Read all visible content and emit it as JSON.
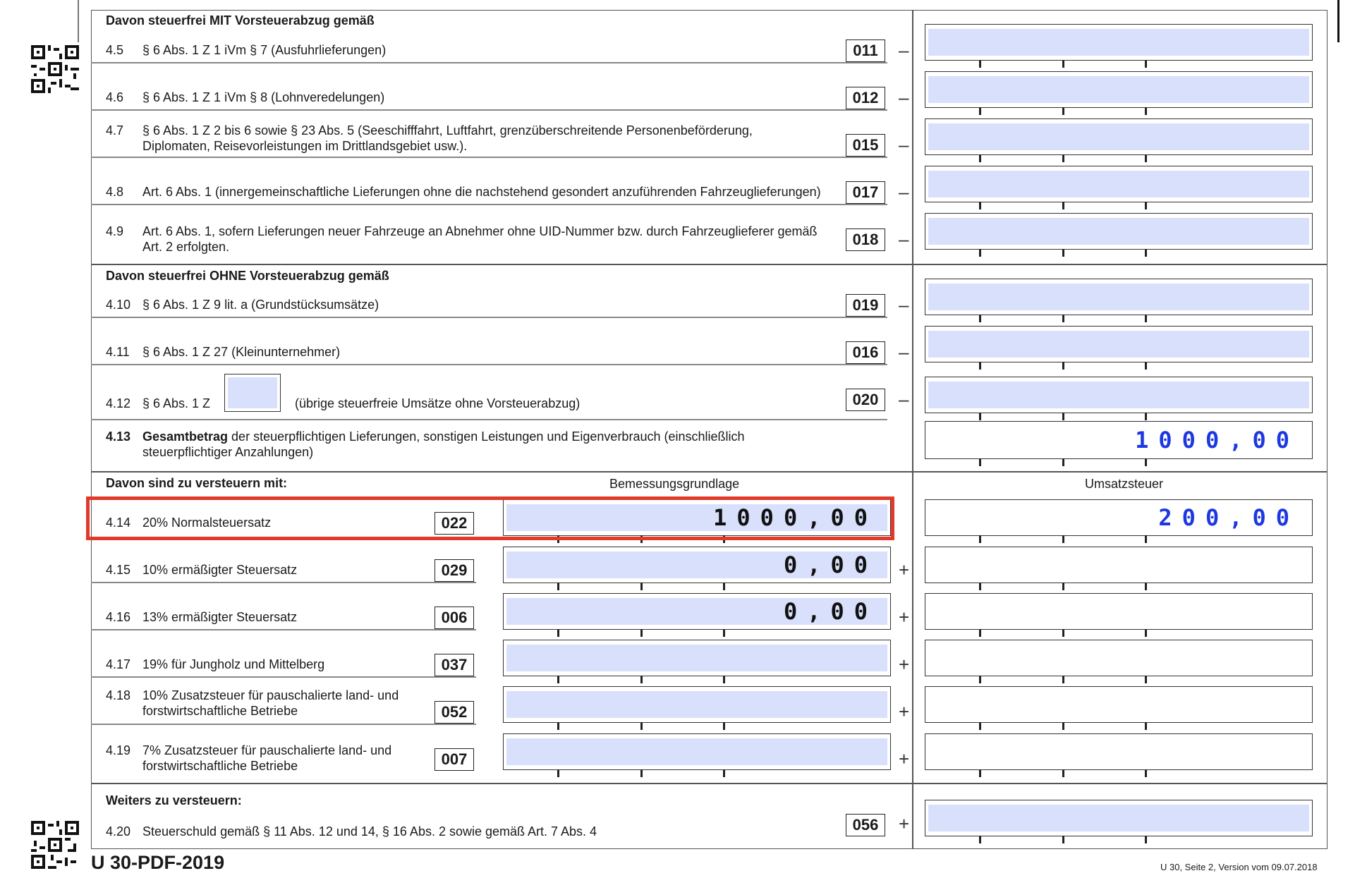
{
  "sections": {
    "mit_vorsteuer": "Davon steuerfrei MIT Vorsteuerabzug gemäß",
    "ohne_vorsteuer": "Davon steuerfrei OHNE Vorsteuerabzug gemäß",
    "zu_versteuern": "Davon sind zu versteuern mit:",
    "weiters": "Weiters zu versteuern:"
  },
  "column_headers": {
    "bemessung": "Bemessungsgrundlage",
    "umsatzsteuer": "Umsatzsteuer"
  },
  "rows_exempt": [
    {
      "num": "4.5",
      "text": "§ 6 Abs. 1 Z 1 iVm § 7 (Ausfuhrlieferungen)",
      "code": "011",
      "sign": "–",
      "value": ""
    },
    {
      "num": "4.6",
      "text": "§ 6 Abs. 1 Z 1 iVm § 8 (Lohnveredelungen)",
      "code": "012",
      "sign": "–",
      "value": ""
    },
    {
      "num": "4.7",
      "text": "§ 6 Abs. 1 Z 2 bis 6 sowie § 23 Abs. 5 (Seeschifffahrt, Luftfahrt, grenzüberschreitende Personenbeförderung, Diplomaten, Reisevorleistungen im Drittlandsgebiet usw.).",
      "code": "015",
      "sign": "–",
      "value": ""
    },
    {
      "num": "4.8",
      "text": "Art. 6 Abs. 1 (innergemeinschaftliche Lieferungen ohne die nachstehend gesondert anzuführenden Fahrzeuglieferungen)",
      "code": "017",
      "sign": "–",
      "value": ""
    },
    {
      "num": "4.9",
      "text": "Art. 6 Abs. 1, sofern Lieferungen neuer Fahrzeuge an Abnehmer ohne UID-Nummer bzw. durch Fahrzeuglieferer gemäß Art. 2 erfolgten.",
      "code": "018",
      "sign": "–",
      "value": ""
    },
    {
      "num": "4.10",
      "text": "§ 6 Abs. 1 Z 9 lit. a (Grundstücksumsätze)",
      "code": "019",
      "sign": "–",
      "value": ""
    },
    {
      "num": "4.11",
      "text": "§ 6 Abs. 1 Z 27 (Kleinunternehmer)",
      "code": "016",
      "sign": "–",
      "value": ""
    },
    {
      "num": "4.12",
      "text_a": "§ 6 Abs. 1 Z",
      "text_b": "(übrige steuerfreie Umsätze ohne Vorsteuerabzug)",
      "code": "020",
      "sign": "–",
      "value": ""
    }
  ],
  "total": {
    "num": "4.13",
    "bold": "Gesamtbetrag",
    "text": " der steuerpflichtigen Lieferungen, sonstigen Leistungen und Eigenverbrauch (einschließlich steuerpflichtiger Anzahlungen)",
    "value": "1000,00"
  },
  "rows_taxed": [
    {
      "num": "4.14",
      "text": "20% Normalsteuersatz",
      "code": "022",
      "base": "1000,00",
      "tax": "200,00",
      "sign": ""
    },
    {
      "num": "4.15",
      "text": "10% ermäßigter Steuersatz",
      "code": "029",
      "base": "0,00",
      "tax": "",
      "sign": "+"
    },
    {
      "num": "4.16",
      "text": "13% ermäßigter Steuersatz",
      "code": "006",
      "base": "0,00",
      "tax": "",
      "sign": "+"
    },
    {
      "num": "4.17",
      "text": "19% für Jungholz und Mittelberg",
      "code": "037",
      "base": "",
      "tax": "",
      "sign": "+"
    },
    {
      "num": "4.18",
      "text": "10% Zusatzsteuer für pauschalierte land- und forstwirtschaftliche Betriebe",
      "code": "052",
      "base": "",
      "tax": "",
      "sign": "+"
    },
    {
      "num": "4.19",
      "text": "7% Zusatzsteuer für pauschalierte land- und forstwirtschaftliche Betriebe",
      "code": "007",
      "base": "",
      "tax": "",
      "sign": "+"
    }
  ],
  "row_420": {
    "num": "4.20",
    "text": "Steuerschuld gemäß § 11 Abs. 12 und 14, § 16 Abs. 2 sowie gemäß Art. 7 Abs. 4",
    "code": "056",
    "sign": "+",
    "value": ""
  },
  "footer": {
    "form_id": "U 30-PDF-2019",
    "version": "U 30, Seite 2, Version vom 09.07.2018"
  },
  "colors": {
    "field_fill": "#d9e0fc",
    "value_blue": "#1d38e0",
    "highlight": "#e23a2a"
  }
}
